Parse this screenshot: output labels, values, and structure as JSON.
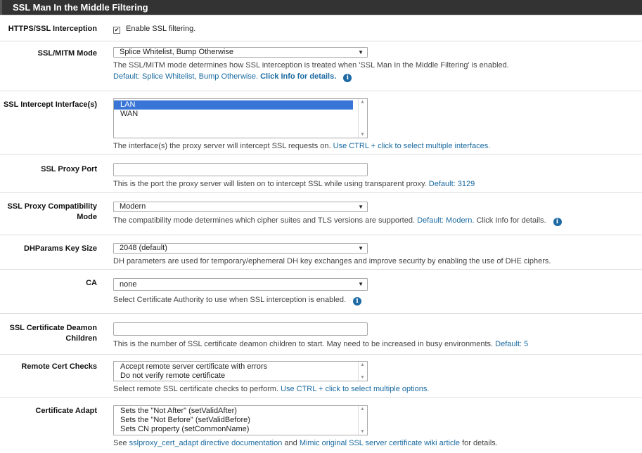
{
  "panel": {
    "title": "SSL Man In the Middle Filtering"
  },
  "rows": {
    "interception": {
      "label": "HTTPS/SSL Interception",
      "checkbox_label": "Enable SSL filtering."
    },
    "mode": {
      "label": "SSL/MITM Mode",
      "value": "Splice Whitelist, Bump Otherwise",
      "help": "The SSL/MITM mode determines how SSL interception is treated when 'SSL Man In the Middle Filtering' is enabled.",
      "default_text": "Default: Splice Whitelist, Bump Otherwise.",
      "info_text": "Click Info for details."
    },
    "interfaces": {
      "label": "SSL Intercept Interface(s)",
      "options": [
        "LAN",
        "WAN"
      ],
      "help": "The interface(s) the proxy server will intercept SSL requests on.",
      "help_link": "Use CTRL + click to select multiple interfaces."
    },
    "port": {
      "label": "SSL Proxy Port",
      "value": "",
      "help": "This is the port the proxy server will listen on to intercept SSL while using transparent proxy.",
      "default_text": "Default: 3129"
    },
    "compat": {
      "label_line1": "SSL Proxy Compatibility",
      "label_line2": "Mode",
      "value": "Modern",
      "help": "The compatibility mode determines which cipher suites and TLS versions are supported.",
      "default_text": "Default: Modern.",
      "info_text": "Click Info for details."
    },
    "dhparams": {
      "label": "DHParams Key Size",
      "value": "2048 (default)",
      "help": "DH parameters are used for temporary/ephemeral DH key exchanges and improve security by enabling the use of DHE ciphers."
    },
    "ca": {
      "label": "CA",
      "value": "none",
      "help": "Select Certificate Authority to use when SSL interception is enabled."
    },
    "children": {
      "label_line1": "SSL Certificate Deamon",
      "label_line2": "Children",
      "value": "",
      "help": "This is the number of SSL certificate deamon children to start. May need to be increased in busy environments.",
      "default_text": "Default: 5"
    },
    "remote_cert": {
      "label": "Remote Cert Checks",
      "options": [
        "Accept remote server certificate with errors",
        "Do not verify remote certificate"
      ],
      "help": "Select remote SSL certificate checks to perform.",
      "help_link": "Use CTRL + click to select multiple options."
    },
    "cert_adapt": {
      "label": "Certificate Adapt",
      "options": [
        "Sets the \"Not After\" (setValidAfter)",
        "Sets the \"Not Before\" (setValidBefore)",
        "Sets CN property (setCommonName)"
      ],
      "help_prefix": "See",
      "link1": "sslproxy_cert_adapt directive documentation",
      "help_mid": "and",
      "link2": "Mimic original SSL server certificate wiki article",
      "help_suffix": "for details."
    }
  },
  "colors": {
    "header_bg": "#333333",
    "link": "#1a6aa0",
    "selected": "#3875d7",
    "info_icon": "#1e6aa5"
  }
}
